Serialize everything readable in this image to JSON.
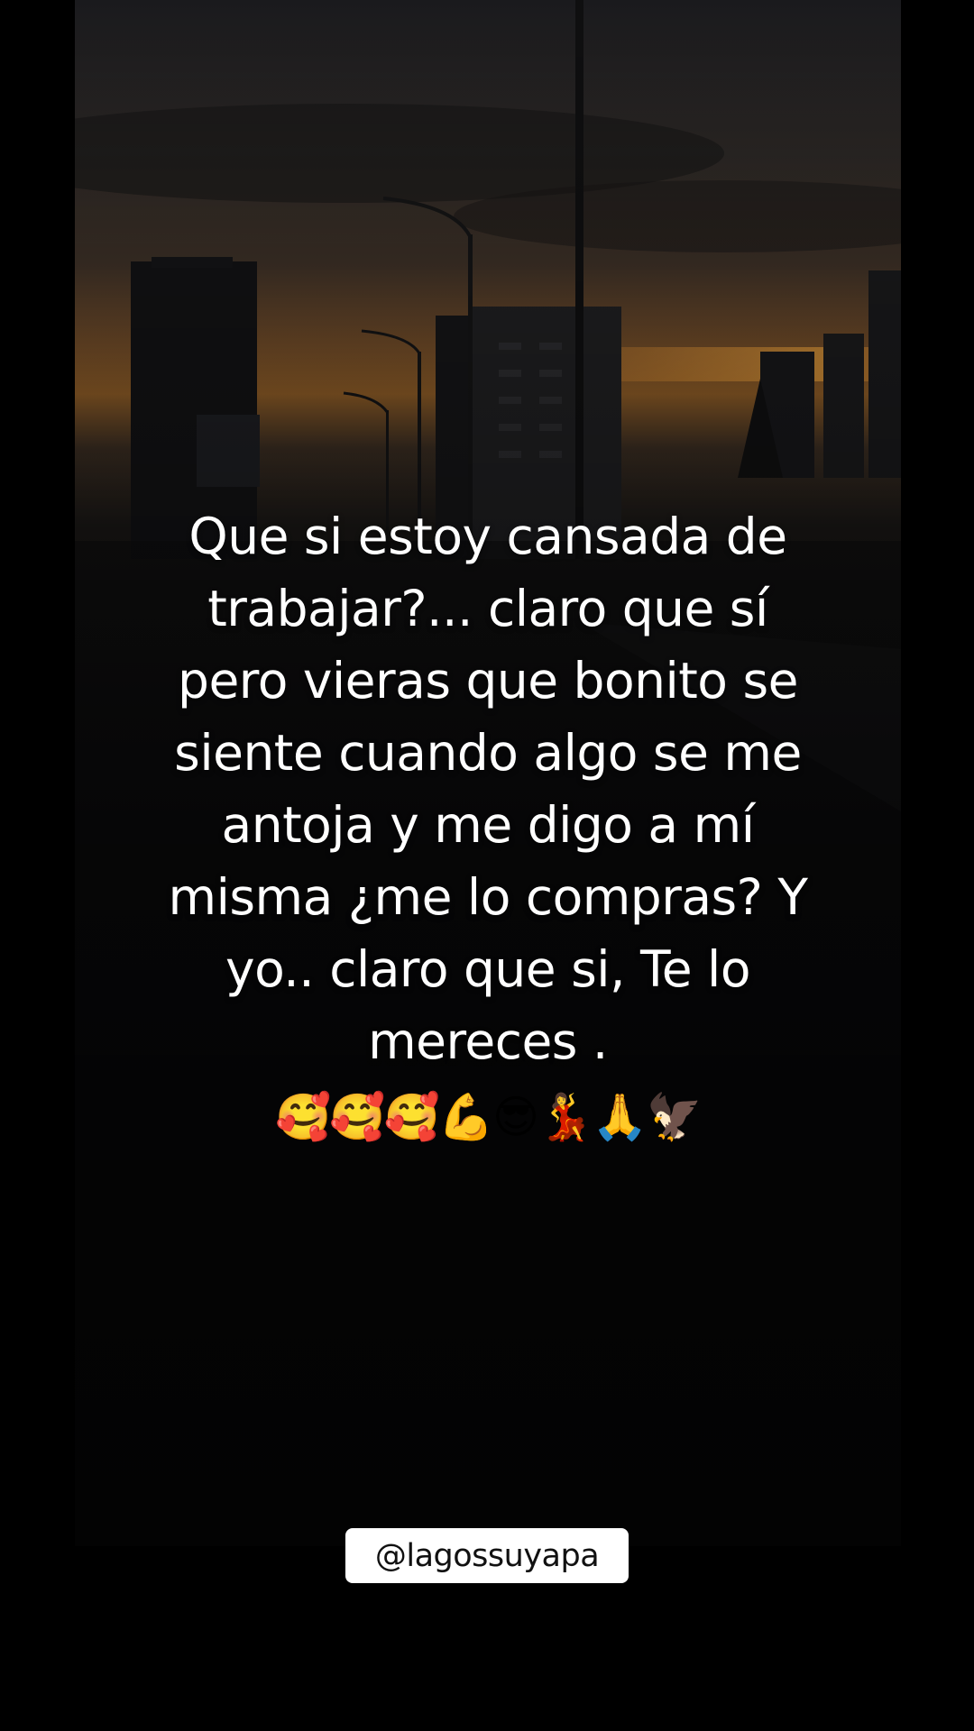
{
  "post": {
    "caption_lines": [
      "Que si estoy cansada de",
      "trabajar?... claro que sí",
      "pero vieras que bonito se",
      "siente cuando algo se me",
      "antoja y me digo a mí",
      "misma ¿me lo compras? Y",
      "yo.. claro que si, Te lo",
      "mereces ."
    ],
    "emojis": "🥰🥰🥰💪😎💃🙏🦅",
    "username": "@lagossuyapa"
  },
  "colors": {
    "background": "#000000",
    "caption_text": "#ffffff",
    "badge_bg": "#ffffff",
    "badge_text": "#111111",
    "sunset_glow": "#c8792a"
  },
  "background_scene": "dusk city skyline with street lamps and buildings"
}
